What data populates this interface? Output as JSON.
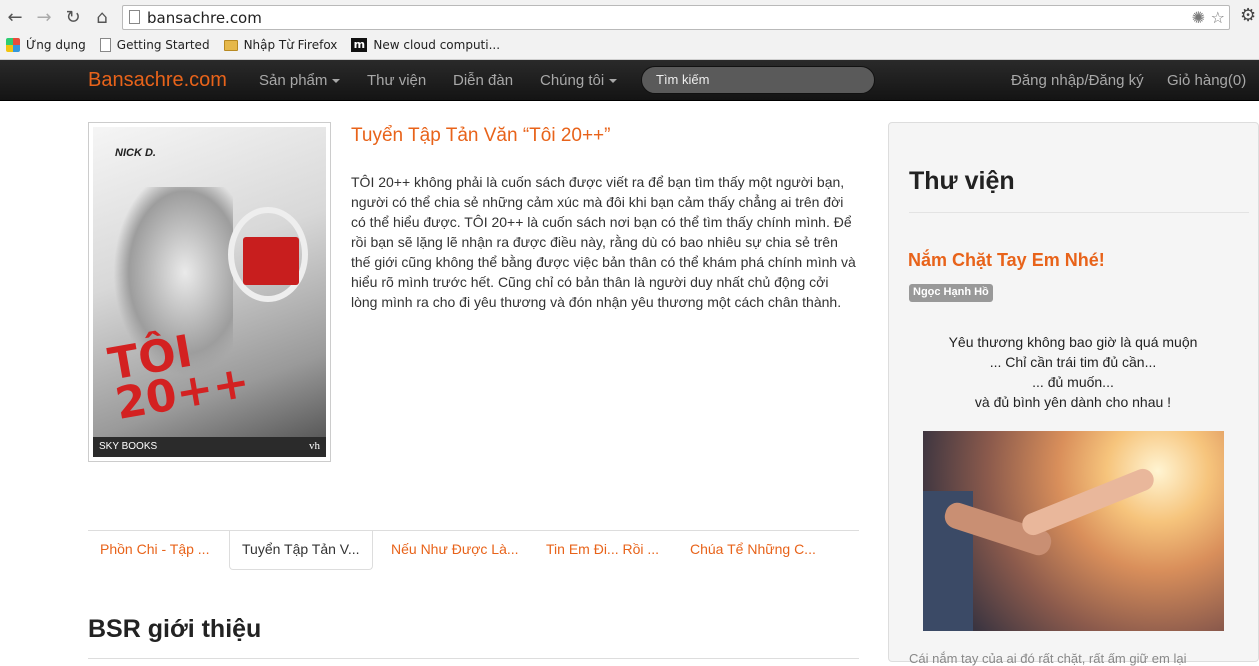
{
  "browser": {
    "url": "bansachre.com",
    "bookmarks": [
      {
        "label": "Ứng dụng"
      },
      {
        "label": "Getting Started"
      },
      {
        "label": "Nhập Từ Firefox"
      },
      {
        "label": "New cloud computi..."
      }
    ]
  },
  "navbar": {
    "brand": "Bansachre.com",
    "items": [
      "Sản phẩm",
      "Thư viện",
      "Diễn đàn",
      "Chúng tôi"
    ],
    "search_placeholder": "Tìm kiếm",
    "login": "Đăng nhập/Đăng ký",
    "cart": "Giỏ hàng(0)"
  },
  "book": {
    "cover_author": "NICK D.",
    "cover_title": "TÔI 20++",
    "cover_publisher": "SKY BOOKS",
    "cover_publisher_right": "vh",
    "title": "Tuyển Tập Tản Văn “Tôi 20++”",
    "description": "TÔI 20++ không phải là cuốn sách được viết ra để bạn tìm thấy một người bạn, người có thể chia sẻ những cảm xúc mà đôi khi bạn cảm thấy chẳng ai trên đời có thể hiểu được. TÔI 20++ là cuốn sách nơi bạn có thể tìm thấy chính mình. Để rồi bạn sẽ lặng lẽ nhận ra được điều này, rằng dù có bao nhiêu sự chia sẻ trên thế giới cũng không thể bằng được việc bản thân có thể khám phá chính mình và hiểu rõ mình trước hết. Cũng chỉ có bản thân là người duy nhất chủ động cởi lòng mình ra cho đi yêu thương và đón nhận yêu thương một cách chân thành."
  },
  "tabs": [
    {
      "label": "Phồn Chi - Tập ..."
    },
    {
      "label": "Tuyển Tập Tản V..."
    },
    {
      "label": "Nếu Như Được Là..."
    },
    {
      "label": "Tin Em Đi... Rồi ..."
    },
    {
      "label": "Chúa Tể Những C..."
    }
  ],
  "section_title": "BSR giới thiệu",
  "sidebar": {
    "title": "Thư viện",
    "post_title": "Nắm Chặt Tay Em Nhé!",
    "author": "Ngọc Hạnh Hồ",
    "poem": [
      "Yêu thương không bao giờ là quá muộn",
      "... Chỉ cần trái tim đủ cần...",
      "... đủ muốn...",
      "và đủ bình yên dành cho nhau !"
    ],
    "cut_text": "Cái nắm tay của ai đó rất chặt, rất ấm giữ em lại"
  },
  "colors": {
    "accent": "#e8631a",
    "navbar_bg": "#1c1c1c"
  }
}
